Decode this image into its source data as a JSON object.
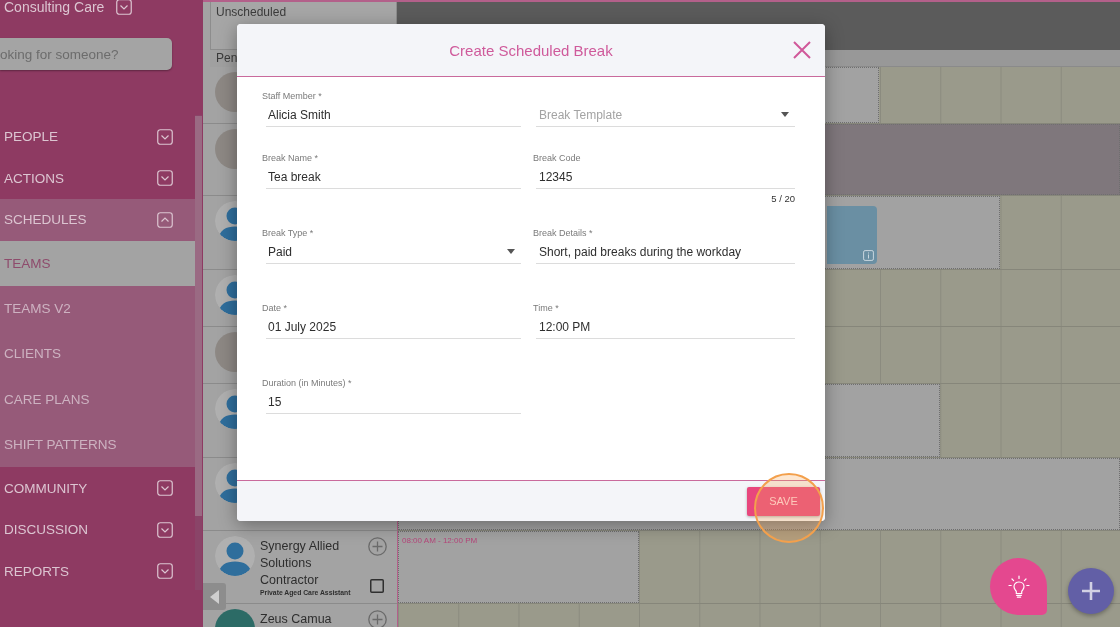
{
  "sidebar": {
    "org_name": "Consulting Care",
    "search": {
      "placeholder": "oking for someone?"
    },
    "items": [
      {
        "label": "PEOPLE",
        "expanded": false,
        "selected": false
      },
      {
        "label": "ACTIONS",
        "expanded": false,
        "selected": false
      },
      {
        "label": "SCHEDULES",
        "expanded": true,
        "selected": false,
        "children": [
          {
            "label": "TEAMS",
            "selected": true
          },
          {
            "label": "TEAMS V2",
            "selected": false
          },
          {
            "label": "CLIENTS",
            "selected": false
          },
          {
            "label": "CARE PLANS",
            "selected": false
          },
          {
            "label": "SHIFT PATTERNS",
            "selected": false
          }
        ]
      },
      {
        "label": "COMMUNITY",
        "expanded": false,
        "selected": false
      },
      {
        "label": "DISCUSSION",
        "expanded": false,
        "selected": false
      },
      {
        "label": "REPORTS",
        "expanded": false,
        "selected": false
      }
    ]
  },
  "schedule": {
    "unscheduled_label": "Unscheduled",
    "pending_label": "Pen",
    "rows": [
      {
        "avatar": {
          "kind": "photo"
        },
        "availability": {
          "kind": "window"
        },
        "shift": false
      },
      {
        "avatar": {
          "kind": "photo"
        },
        "availability": {
          "kind": "unavailable"
        },
        "shift": false
      },
      {
        "avatar": {
          "kind": "generic"
        },
        "availability": {
          "kind": "window"
        },
        "shift": true
      },
      {
        "avatar": {
          "kind": "generic"
        },
        "shift": false
      },
      {
        "avatar": {
          "kind": "photo"
        },
        "shift": false
      },
      {
        "avatar": {
          "kind": "generic"
        },
        "availability": {
          "kind": "window"
        },
        "shift": false
      },
      {
        "avatar": {
          "kind": "generic"
        },
        "availability": {
          "kind": "window"
        },
        "shift": false
      },
      {
        "avatar": {
          "kind": "generic"
        },
        "name": "Synergy Allied Solutions Contractor",
        "role": "Private Aged Care Assistant",
        "checked": false,
        "availability": {
          "kind": "window",
          "label": "08:00 AM - 12:00 PM"
        },
        "shift": false
      },
      {
        "avatar": {
          "kind": "illustrated"
        },
        "name": "Zeus Camua",
        "shift": false
      }
    ]
  },
  "dialog": {
    "title": "Create Scheduled Break",
    "fields": [
      {
        "kind": "text",
        "label": "Staff Member *",
        "value": "Alicia Smith"
      },
      {
        "kind": "select",
        "placeholder": "Break Template"
      },
      {
        "kind": "text",
        "label": "Break Name *",
        "value": "Tea break"
      },
      {
        "kind": "text",
        "label": "Break Code",
        "value": "12345",
        "counter": "5 / 20"
      },
      {
        "kind": "select",
        "label": "Break Type *",
        "value": "Paid"
      },
      {
        "kind": "text",
        "label": "Break Details *",
        "value": "Short, paid breaks during the workday"
      },
      {
        "kind": "text",
        "label": "Date *",
        "value": "01 July 2025"
      },
      {
        "kind": "text",
        "label": "Time *",
        "value": "12:00 PM"
      },
      {
        "kind": "text",
        "label": "Duration (in Minutes) *",
        "value": "15"
      }
    ],
    "save_button": "SAVE"
  }
}
